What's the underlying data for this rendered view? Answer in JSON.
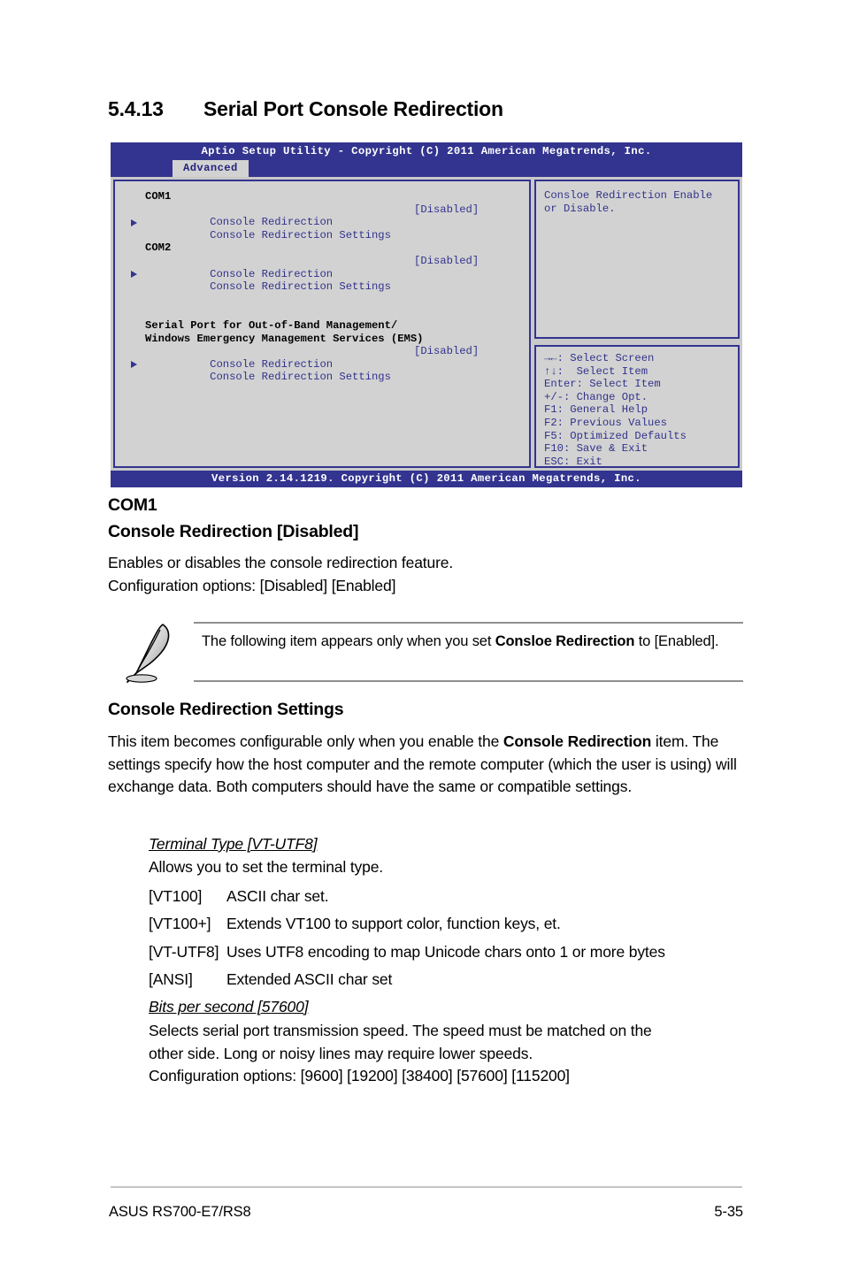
{
  "section": {
    "number": "5.4.13",
    "title": "Serial Port Console Redirection"
  },
  "bios": {
    "title_bar": "Aptio Setup Utility - Copyright (C) 2011 American Megatrends, Inc.",
    "active_tab": "Advanced",
    "groups": [
      {
        "header": "COM1",
        "items": [
          {
            "label": "Console Redirection",
            "value": "[Disabled]",
            "submenu": false
          },
          {
            "label": "Console Redirection Settings",
            "value": "",
            "submenu": true
          }
        ]
      },
      {
        "header": "COM2",
        "items": [
          {
            "label": "Console Redirection",
            "value": "[Disabled]",
            "submenu": false
          },
          {
            "label": "Console Redirection Settings",
            "value": "",
            "submenu": true
          }
        ]
      },
      {
        "header": "Serial Port for Out-of-Band Management/",
        "header2": "Windows Emergency Management Services (EMS)",
        "items": [
          {
            "label": "Console Redirection",
            "value": "[Disabled]",
            "submenu": false
          },
          {
            "label": "Console Redirection Settings",
            "value": "",
            "submenu": true
          }
        ]
      }
    ],
    "help_lines": [
      "Consloe Redirection Enable",
      "or Disable."
    ],
    "key_legend": [
      "→←: Select Screen",
      "↑↓:  Select Item",
      "Enter: Select Item",
      "+/-: Change Opt.",
      "F1: General Help",
      "F2: Previous Values",
      "F5: Optimized Defaults",
      "F10: Save & Exit",
      "ESC: Exit"
    ],
    "footer_bar": "Version 2.14.1219. Copyright (C) 2011 American Megatrends, Inc.",
    "colors": {
      "header_blue": "#33348f",
      "panel_gray": "#d2d2d2",
      "screen_gray": "#c9c9c9",
      "text_blue": "#32328c"
    }
  },
  "com1_block": {
    "heading1": "COM1",
    "heading2": "Console Redirection [Disabled]",
    "desc_line1": "Enables or disables the console redirection feature.",
    "desc_line2": "Configuration options: [Disabled] [Enabled]"
  },
  "note": {
    "icon": "note-pencil-icon",
    "text_before": "The following item appears only when you set ",
    "text_bold": "Consloe Redirection",
    "text_after": " to [Enabled]."
  },
  "settings_block": {
    "heading": "Console Redirection Settings",
    "body_before": "This item becomes configurable only when you enable the ",
    "body_bold": "Console Redirection",
    "body_after": " item. The settings specify how the host computer and the remote computer (which the user is using) will exchange data. Both computers should have the same or compatible settings."
  },
  "terminal_type": {
    "title": "Terminal Type [VT-UTF8]",
    "desc": "Allows you to set the terminal type.",
    "options": [
      {
        "tag": "[VT100]",
        "text": "ASCII char set."
      },
      {
        "tag": "[VT100+]",
        "text": "Extends VT100 to support color, function keys, et."
      },
      {
        "tag": "[VT-UTF8]",
        "text": "Uses UTF8 encoding to map Unicode chars onto 1 or more bytes"
      },
      {
        "tag": "[ANSI]",
        "text": "Extended ASCII char set"
      }
    ]
  },
  "bits_per_second": {
    "title": "Bits per second [57600]",
    "line1": "Selects serial port transmission speed. The speed must be matched on the",
    "line2": "other side. Long or noisy lines may require lower speeds.",
    "line3": "Configuration options: [9600] [19200] [38400] [57600] [115200]"
  },
  "footer": {
    "product": "ASUS RS700-E7/RS8",
    "page": "5-35"
  }
}
